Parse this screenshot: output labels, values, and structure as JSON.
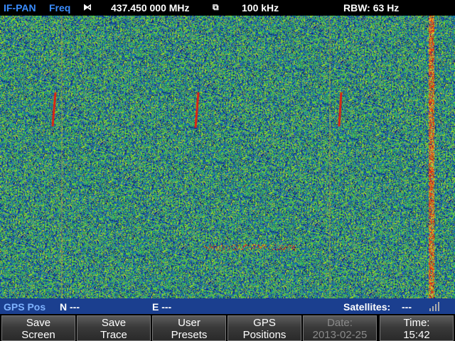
{
  "header": {
    "mode": "IF-PAN",
    "param": "Freq",
    "center_icon": "center-marker-icon",
    "frequency": "437.450 000 MHz",
    "span_icon": "span-marker-icon",
    "span": "100 kHz",
    "rbw": "RBW: 63 Hz"
  },
  "status": {
    "gps_label": "GPS Pos",
    "north": "N ---",
    "east": "E ---",
    "satellites_label": "Satellites:",
    "satellites_value": "---",
    "signal_icon": "signal-strength-icon"
  },
  "softkeys": [
    {
      "line1": "Save",
      "line2": "Screen",
      "enabled": true
    },
    {
      "line1": "Save",
      "line2": "Trace",
      "enabled": true
    },
    {
      "line1": "User",
      "line2": "Presets",
      "enabled": true
    },
    {
      "line1": "GPS",
      "line2": "Positions",
      "enabled": true
    },
    {
      "line1": "Date:",
      "line2": "2013-02-25",
      "enabled": false
    },
    {
      "line1": "Time:",
      "line2": "15:42",
      "enabled": true
    }
  ],
  "colors": {
    "accent_blue": "#3a8dff",
    "status_bar": "#1b3f8f",
    "signal_red": "#e02010",
    "noise_green": "#30c060",
    "noise_blue": "#1030a0"
  }
}
